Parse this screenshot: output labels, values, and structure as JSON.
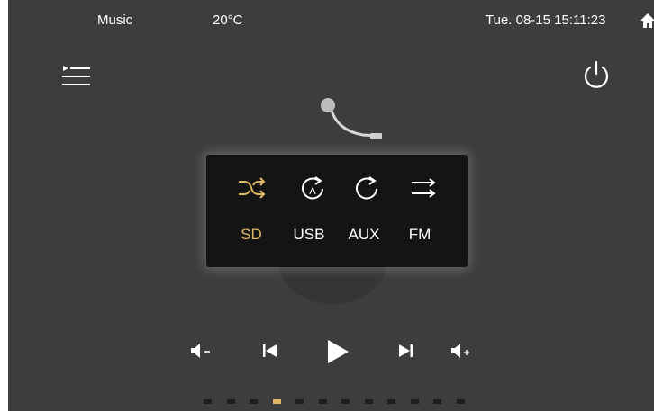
{
  "status_bar": {
    "app_name": "Music",
    "temperature": "20°C",
    "datetime": "Tue. 08-15 15:11:23",
    "home_icon": "home-icon"
  },
  "toolbar": {
    "playlist_icon": "playlist-icon",
    "power_icon": "power-icon"
  },
  "source_popup": {
    "mode_icons": [
      "shuffle-icon",
      "repeat-all-icon",
      "repeat-icon",
      "sequential-icon"
    ],
    "sources": [
      {
        "label": "SD",
        "active": true
      },
      {
        "label": "USB",
        "active": false
      },
      {
        "label": "AUX",
        "active": false
      },
      {
        "label": "FM",
        "active": false
      }
    ]
  },
  "playback_controls": [
    "volume-down-icon",
    "previous-icon",
    "play-icon",
    "next-icon",
    "volume-up-icon"
  ],
  "pager": {
    "total": 12,
    "active_index": 3
  },
  "colors": {
    "background": "#3d3d3d",
    "popup": "#141414",
    "accent": "#e2b866",
    "text": "#ffffff"
  }
}
